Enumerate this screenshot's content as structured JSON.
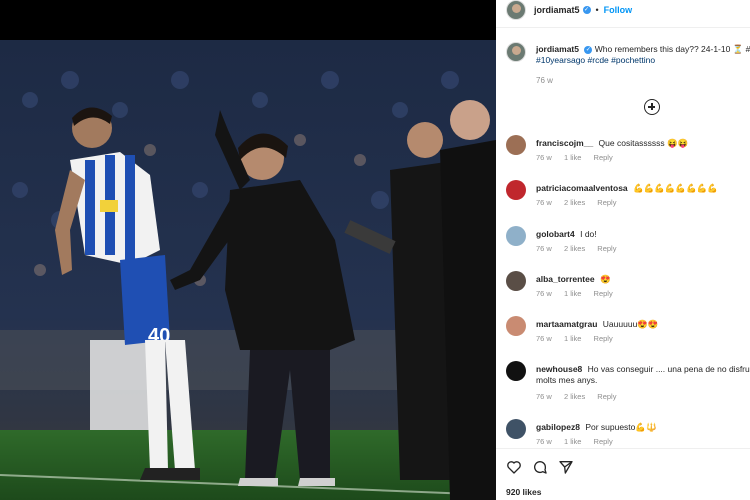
{
  "post": {
    "username": "jordiamat5",
    "follow_label": "Follow",
    "separator": "•",
    "caption": {
      "text": "Who remembers this day?? 24-1-10 ⏳ #",
      "tags": "#10yearsago #rcde #pochettino",
      "time": "76 w"
    },
    "likes": "920 likes"
  },
  "comments": [
    {
      "user": "franciscojm__",
      "text": "Que cositassssss 😝😝",
      "time": "76 w",
      "likes": "1 like",
      "reply": "Reply"
    },
    {
      "user": "patriciacomaalventosa",
      "text": "💪💪💪💪💪💪💪💪",
      "time": "76 w",
      "likes": "2 likes",
      "reply": "Reply"
    },
    {
      "user": "golobart4",
      "text": "I do!",
      "time": "76 w",
      "likes": "2 likes",
      "reply": "Reply"
    },
    {
      "user": "alba_torrentee",
      "text": "😍",
      "time": "76 w",
      "likes": "1 like",
      "reply": "Reply"
    },
    {
      "user": "martaamatgrau",
      "text": "Uauuuuu😍😍",
      "time": "76 w",
      "likes": "1 like",
      "reply": "Reply"
    },
    {
      "user": "newhouse8",
      "text": "Ho vas conseguir .... una pena de no disfru",
      "text2": "molts mes anys.",
      "time": "76 w",
      "likes": "2 likes",
      "reply": "Reply"
    },
    {
      "user": "gabilopez8",
      "text": "Por supuesto💪🔱",
      "time": "76 w",
      "likes": "1 like",
      "reply": "Reply"
    }
  ],
  "colors": {
    "accent": "#0095f6",
    "verified": "#3897f0",
    "kit_blue": "#1f4fb3"
  },
  "icons": [
    "heart-icon",
    "comment-icon",
    "share-icon",
    "plus-circle-icon",
    "verified-icon"
  ]
}
